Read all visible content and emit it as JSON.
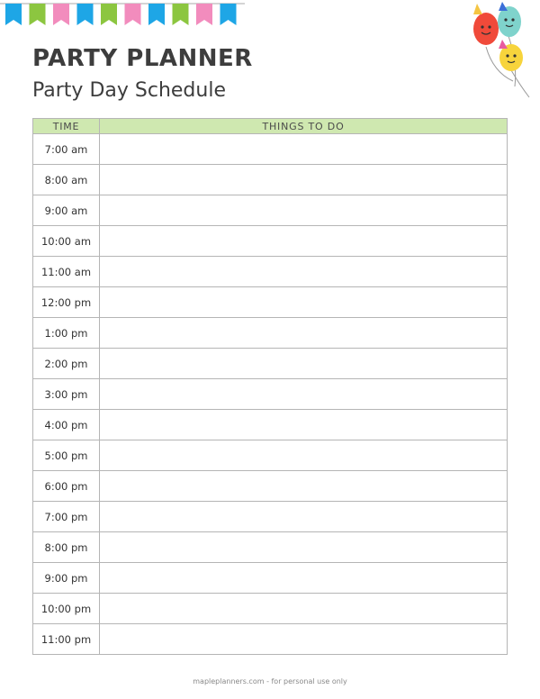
{
  "title": "PARTY PLANNER",
  "subtitle": "Party Day Schedule",
  "table": {
    "headers": {
      "time": "TIME",
      "todo": "THINGS TO DO"
    },
    "times": [
      "7:00 am",
      "8:00 am",
      "9:00 am",
      "10:00 am",
      "11:00 am",
      "12:00 pm",
      "1:00 pm",
      "2:00 pm",
      "3:00 pm",
      "4:00 pm",
      "5:00 pm",
      "6:00 pm",
      "7:00 pm",
      "8:00 pm",
      "9:00 pm",
      "10:00 pm",
      "11:00 pm"
    ]
  },
  "footer": "mapleplanners.com - for personal use only",
  "colors": {
    "header_bg": "#cfe8b0",
    "flag_blue": "#1ea6e6",
    "flag_green": "#8cc640",
    "flag_pink": "#f28cbd"
  },
  "decorations": {
    "bunting_flags": [
      "blue",
      "green",
      "pink",
      "blue",
      "green",
      "pink",
      "blue",
      "green",
      "pink",
      "blue"
    ],
    "balloons": [
      "red",
      "teal",
      "yellow"
    ]
  }
}
